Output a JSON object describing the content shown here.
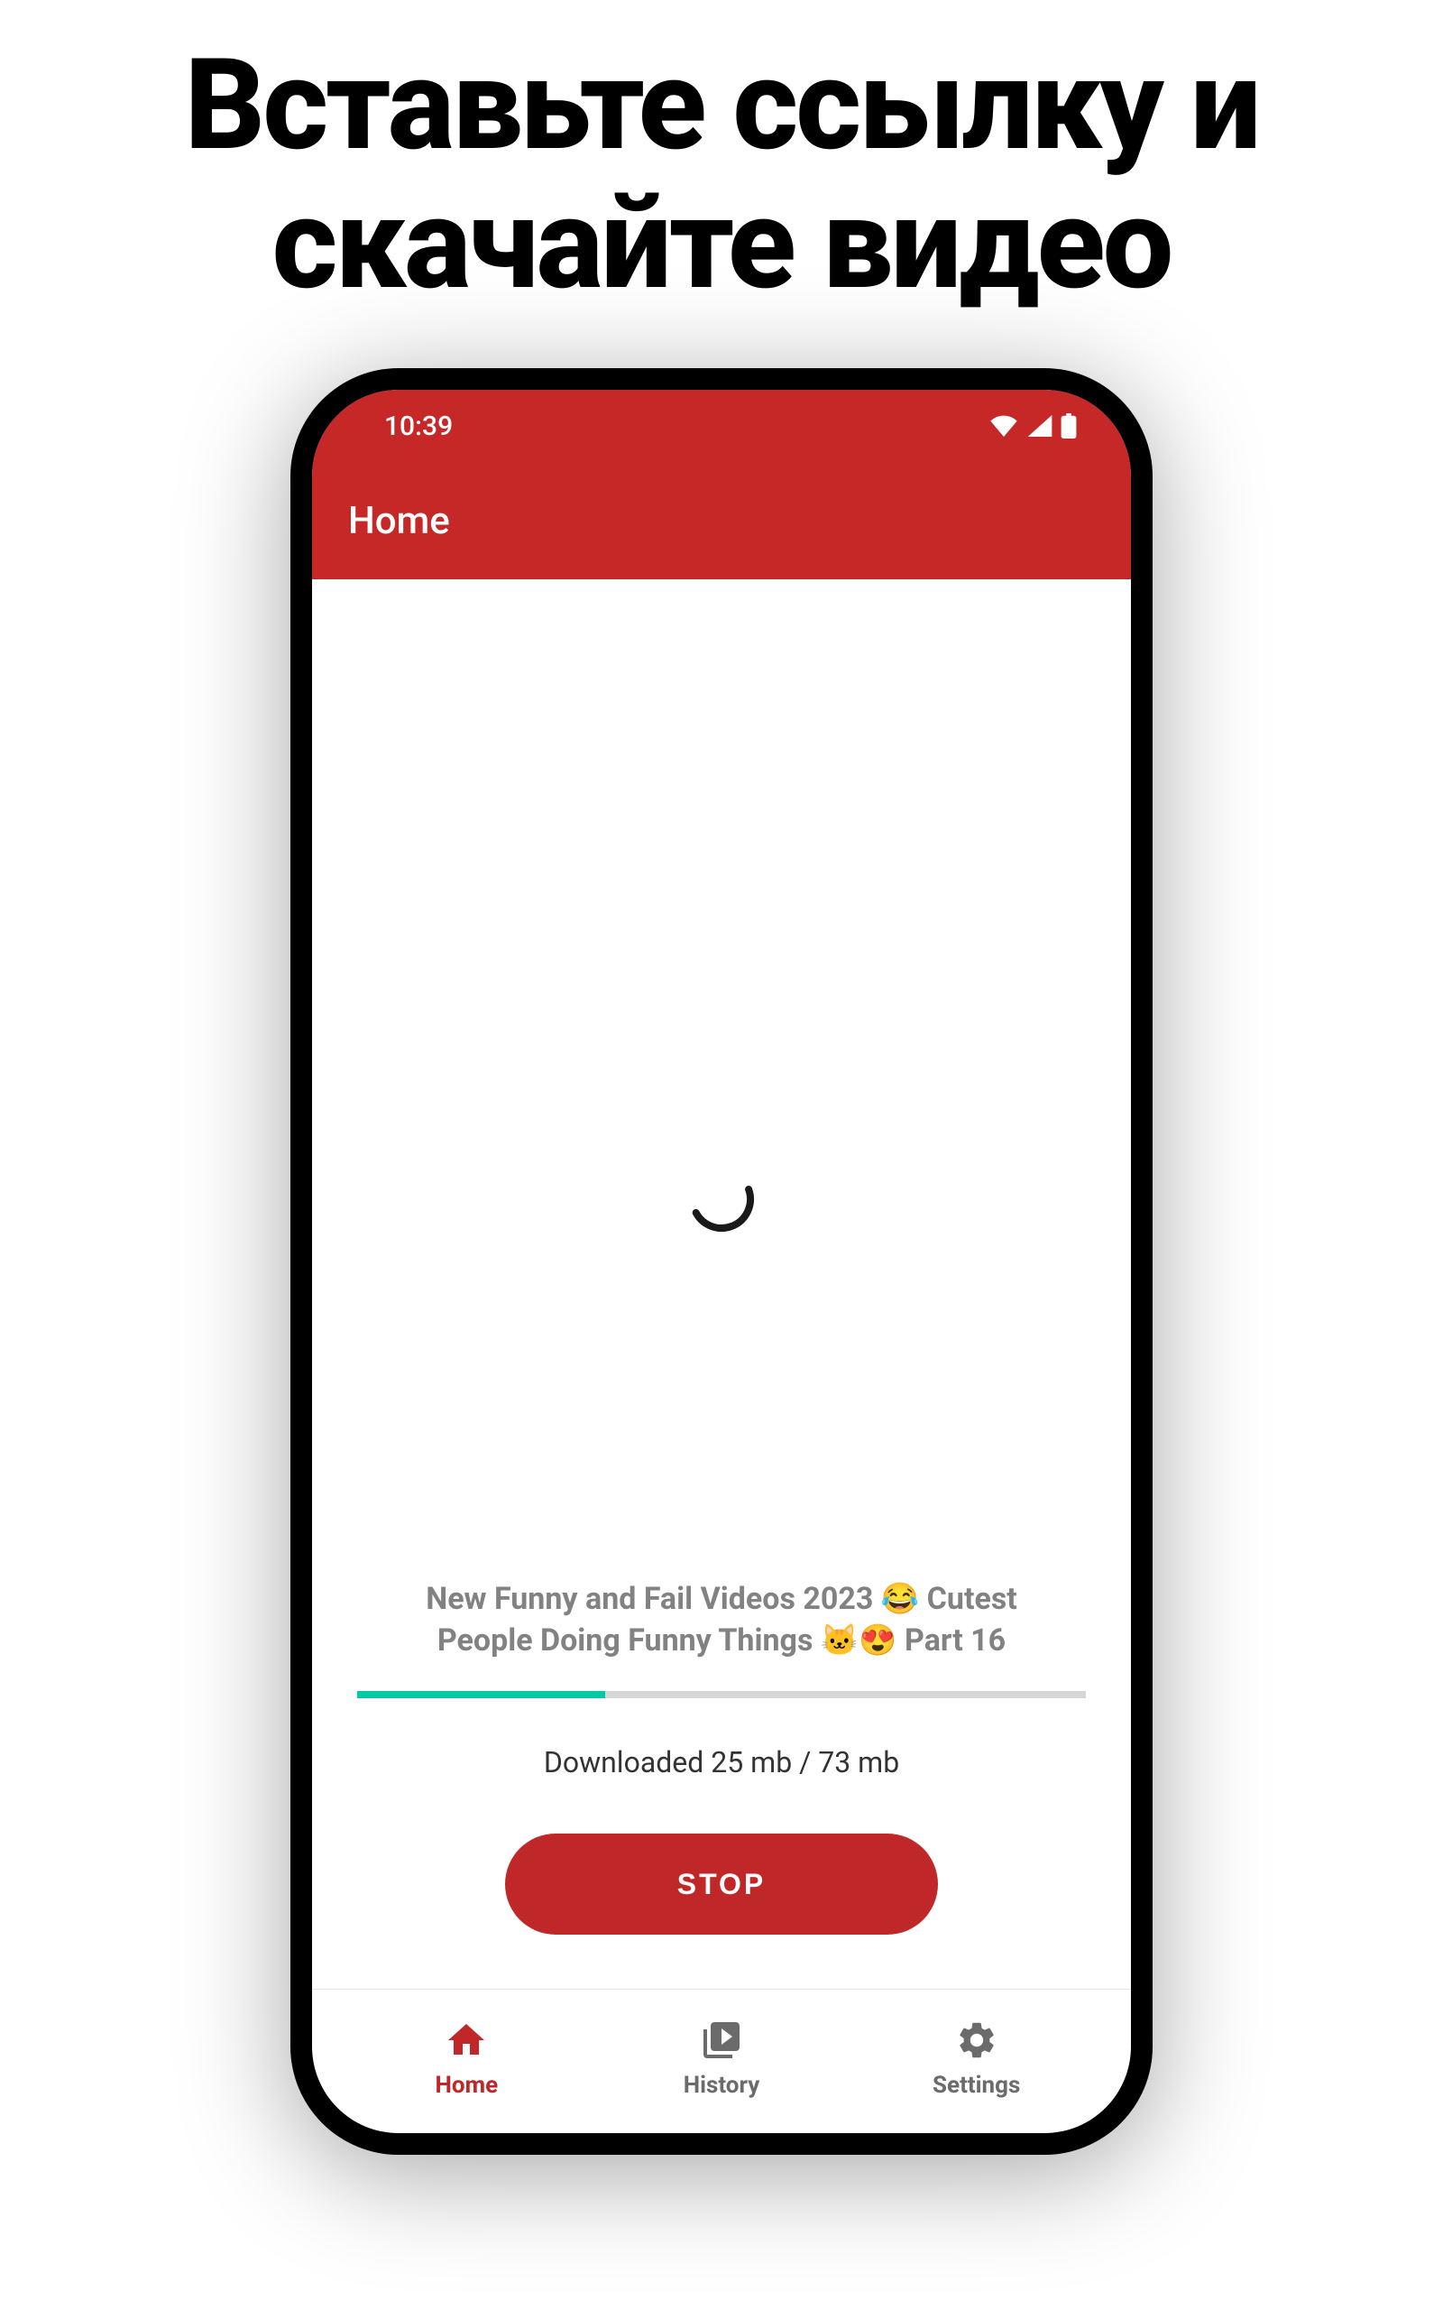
{
  "headline": "Вставьте ссылку и скачайте видео",
  "status_bar": {
    "time": "10:39"
  },
  "app_bar": {
    "title": "Home"
  },
  "download": {
    "video_title": "New Funny and Fail Videos 2023 😂 Cutest People Doing Funny Things 🐱😍 Part 16",
    "status_text": "Downloaded 25 mb / 73 mb",
    "progress_percent": 34,
    "stop_label": "STOP"
  },
  "nav": {
    "items": [
      {
        "label": "Home",
        "icon": "home-icon",
        "active": true
      },
      {
        "label": "History",
        "icon": "history-icon",
        "active": false
      },
      {
        "label": "Settings",
        "icon": "settings-icon",
        "active": false
      }
    ]
  },
  "colors": {
    "primary": "#C62828",
    "accent": "#00C9A7",
    "stop_bg": "#C02728"
  }
}
